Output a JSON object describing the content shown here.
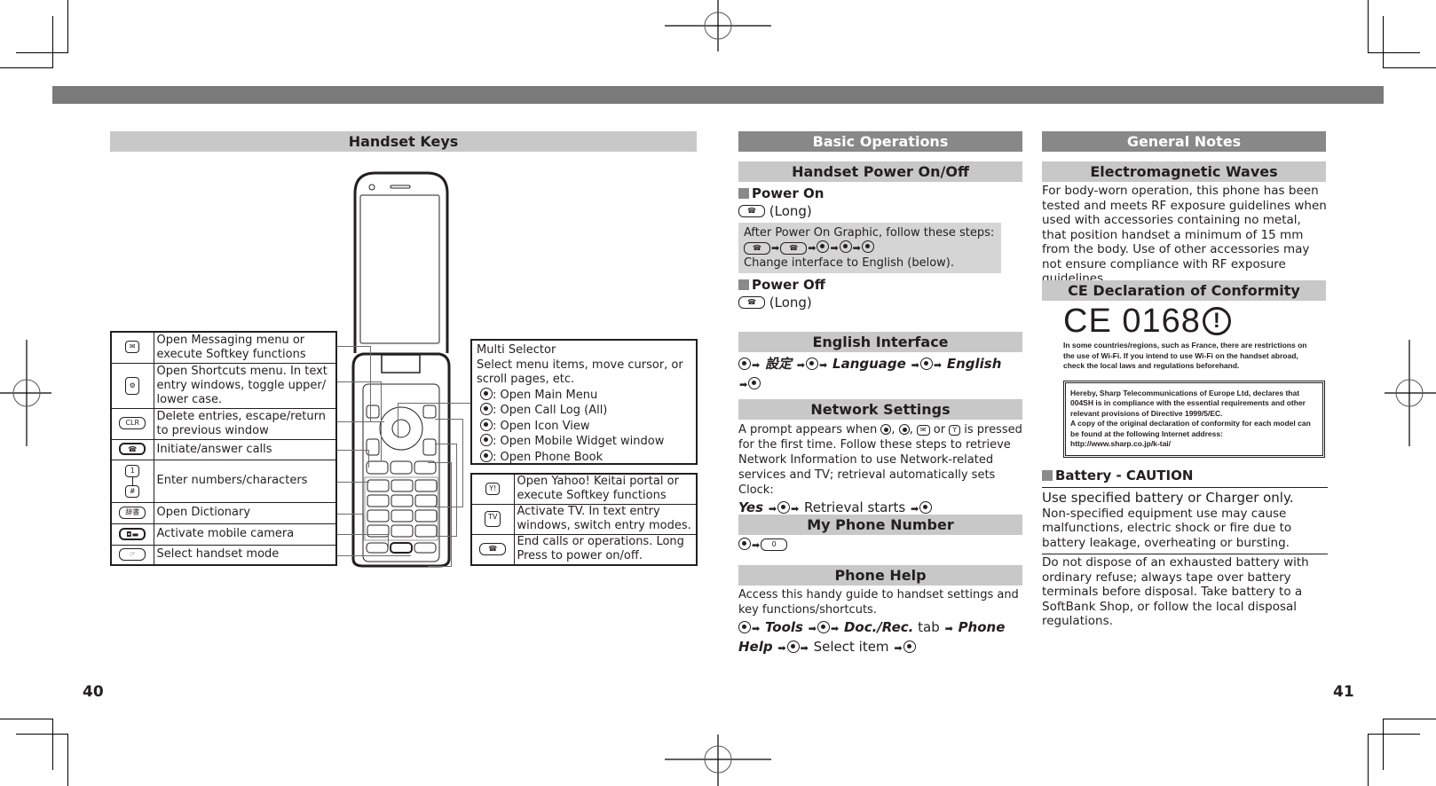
{
  "page": {
    "left_number": "40",
    "right_number": "41"
  },
  "handset_keys": {
    "title": "Handset Keys",
    "left_table": [
      {
        "icon": "mail-key-icon",
        "glyph": "✉",
        "text": "Open Messaging menu or execute Softkey functions"
      },
      {
        "icon": "shortcut-key-icon",
        "glyph": "⚙",
        "text": "Open Shortcuts menu. In text entry windows, toggle upper/ lower case."
      },
      {
        "icon": "clear-key-icon",
        "glyph": "CLR",
        "text": "Delete entries, escape/return to previous window"
      },
      {
        "icon": "call-key-icon",
        "glyph": "☎",
        "text": "Initiate/answer calls"
      },
      {
        "icon": "keypad-range-icon",
        "glyph_top": "1",
        "glyph_bottom": "#",
        "text": "Enter numbers/characters"
      },
      {
        "icon": "dictionary-key-icon",
        "glyph": "辞書",
        "text": "Open Dictionary"
      },
      {
        "icon": "camera-key-icon",
        "glyph": "◘▬",
        "text": "Activate mobile camera"
      },
      {
        "icon": "mode-key-icon",
        "glyph": "☞",
        "text": "Select handset mode"
      }
    ],
    "multi_selector": {
      "title": "Multi Selector",
      "description": "Select menu items, move cursor, or scroll pages, etc.",
      "items": [
        {
          "icon": "center-press-icon",
          "text": ": Open Main Menu"
        },
        {
          "icon": "left-press-icon",
          "text": ": Open Call Log (All)"
        },
        {
          "icon": "right-press-icon",
          "text": ": Open Icon View"
        },
        {
          "icon": "up-press-icon",
          "text": ": Open Mobile Widget window"
        },
        {
          "icon": "down-press-icon",
          "text": ": Open Phone Book"
        }
      ]
    },
    "right_table": [
      {
        "icon": "yahoo-key-icon",
        "glyph": "Y!",
        "text": "Open Yahoo! Keitai portal or execute Softkey functions"
      },
      {
        "icon": "tv-key-icon",
        "glyph": "TV",
        "text": "Activate TV. In text entry windows, switch entry modes."
      },
      {
        "icon": "end-key-icon",
        "glyph": "☎",
        "text": "End calls or operations. Long Press to power on/off."
      }
    ]
  },
  "basic_operations": {
    "title": "Basic Operations",
    "power": {
      "title": "Handset Power On/Off",
      "on_label": "Power On",
      "on_step": "(Long)",
      "note_line1": "After Power On Graphic, follow these steps:",
      "note_line3": "Change interface to English (below).",
      "off_label": "Power Off",
      "off_step": "(Long)"
    },
    "english": {
      "title": "English Interface",
      "step1": "設定",
      "step2": "Language",
      "step3": "English"
    },
    "network": {
      "title": "Network Settings",
      "text_a": "A prompt appears when",
      "text_b": "or",
      "text_c": "is pressed for the first time. Follow these steps to retrieve Network Information to use Network-related services and TV; retrieval automatically sets Clock:",
      "yes": "Yes",
      "retrieval": "Retrieval starts"
    },
    "my_number": {
      "title": "My Phone Number"
    },
    "help": {
      "title": "Phone Help",
      "text": "Access this handy guide to handset settings and key functions/shortcuts.",
      "tools": "Tools",
      "docrec": "Doc./Rec.",
      "tab": "tab",
      "phone_help": "Phone Help",
      "select": "Select item"
    }
  },
  "general_notes": {
    "title": "General Notes",
    "em": {
      "title": "Electromagnetic Waves",
      "text": "For body-worn operation, this phone has been tested and meets RF exposure guidelines when used with accessories containing no metal, that position handset a minimum of 15 mm from the body. Use of other accessories may not ensure compliance with RF exposure guidelines."
    },
    "ce": {
      "title": "CE Declaration of Conformity",
      "mark": "CE 0168",
      "wifi_note": "In some countries/regions, such as France, there are restrictions on the use of Wi-Fi. If you intend to use Wi-Fi on the handset abroad, check the local laws and regulations beforehand.",
      "declaration_line1": "Hereby, Sharp Telecommunications of Europe Ltd, declares that 004SH is in compliance with the essential requirements and other relevant provisions of Directive 1999/5/EC.",
      "declaration_line2": "A copy of the original declaration of conformity for each model can be found at the following Internet address:",
      "url": "http://www.sharp.co.jp/k-tai/"
    },
    "battery": {
      "title": "Battery - CAUTION",
      "subtitle": "Use specified battery or Charger only.",
      "text1": "Non-specified equipment use may cause malfunctions, electric shock or fire due to battery leakage, overheating or bursting.",
      "text2": "Do not dispose of an exhausted battery with ordinary refuse; always tape over battery terminals before disposal. Take battery to a SoftBank Shop, or follow the local disposal regulations."
    }
  }
}
